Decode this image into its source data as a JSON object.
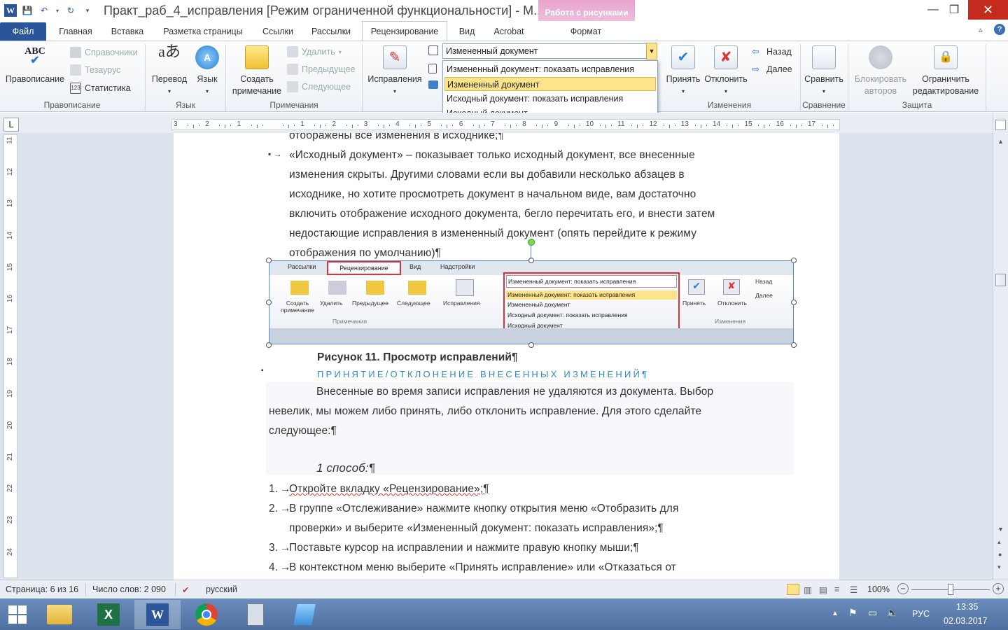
{
  "window": {
    "title": "Практ_раб_4_исправления [Режим ограниченной функциональности]  -  M..",
    "context_tab_title": "Работа с рисунками",
    "minimize_icon": "minimize-icon",
    "restore_icon": "restore-icon",
    "close_icon": "close-icon"
  },
  "tabs": [
    {
      "label": "Файл"
    },
    {
      "label": "Главная"
    },
    {
      "label": "Вставка"
    },
    {
      "label": "Разметка страницы"
    },
    {
      "label": "Ссылки"
    },
    {
      "label": "Рассылки"
    },
    {
      "label": "Рецензирование"
    },
    {
      "label": "Вид"
    },
    {
      "label": "Acrobat"
    },
    {
      "label": "Формат"
    }
  ],
  "ribbon": {
    "spelling": {
      "label": "Правописание",
      "references": "Справочники",
      "thesaurus": "Тезаурус",
      "stats": "Статистика",
      "group": "Правописание"
    },
    "language": {
      "translate": "Перевод",
      "lang": "Язык",
      "group": "Язык"
    },
    "comments": {
      "create": "Создать примечание",
      "delete": "Удалить",
      "prev": "Предыдущее",
      "next": "Следующее",
      "group": "Примечания"
    },
    "tracking": {
      "track": "Исправления"
    },
    "display_dropdown": {
      "value": "Измененный документ",
      "options": [
        "Измененный документ: показать исправления",
        "Измененный документ",
        "Исходный документ: показать исправления",
        "Исходный документ"
      ]
    },
    "changes": {
      "accept": "Принять",
      "reject": "Отклонить",
      "back": "Назад",
      "forward": "Далее",
      "group": "Изменения"
    },
    "compare": {
      "label": "Сравнить",
      "group": "Сравнение"
    },
    "protect": {
      "block": "Блокировать авторов",
      "restrict": "Ограничить редактирование",
      "group": "Защита"
    }
  },
  "document": {
    "lines": [
      "отображены все изменения в исходнике;¶",
      "«Исходный документ» – показывает только исходный документ, все внесенные",
      "изменения скрыты. Другими словами если вы добавили несколько абзацев в",
      "исходнике, но хотите просмотреть документ в начальном виде, вам достаточно",
      "включить отображение исходного документа, бегло перечитать его, и внести затем",
      "недостающие исправления в измененный документ (опять перейдите к режиму",
      "отображения по умолчанию)¶"
    ],
    "figure": {
      "tabs": [
        "Рассылки",
        "Рецензирование",
        "Вид",
        "Надстройки"
      ],
      "buttons": [
        "Создать примечание",
        "Удалить",
        "Предыдущее",
        "Следующее",
        "Исправления",
        "Принять",
        "Отклонить",
        "Назад",
        "Далее"
      ],
      "group_comments": "Примечания",
      "group_changes": "Изменения",
      "dropdown_value": "Измененный документ: показать исправления",
      "dropdown_options": [
        "Измененный документ: показать исправления",
        "Измененный документ",
        "Исходный документ: показать исправления",
        "Исходный документ"
      ]
    },
    "caption": "Рисунок 11. Просмотр исправлений¶",
    "heading": "ПРИНЯТИЕ/ОТКЛОНЕНИЕ ВНЕСЕННЫХ ИЗМЕНЕНИЙ¶",
    "para": [
      "Внесенные во время записи исправления не удаляются из документа. Выбор",
      "невелик, мы можем либо принять, либо отклонить исправление. Для этого сделайте",
      "следующее:¶"
    ],
    "method": "1 способ:¶",
    "list": [
      {
        "num": "1.",
        "text": "Откройте вкладку «Рецензирование»;¶"
      },
      {
        "num": "2.",
        "text": "В группе «Отслеживание» нажмите кнопку открытия меню «Отобразить для"
      },
      {
        "num": "",
        "text": "проверки» и выберите «Измененный документ: показать исправления»;¶"
      },
      {
        "num": "3.",
        "text": "Поставьте курсор на исправлении и нажмите правую кнопку мыши;¶"
      },
      {
        "num": "4.",
        "text": "В контекстном меню выберите «Принять исправление» или «Отказаться от"
      }
    ]
  },
  "status": {
    "page": "Страница: 6 из 16",
    "words": "Число слов: 2 090",
    "lang": "русский",
    "zoom": "100%"
  },
  "taskbar": {
    "lang": "РУС",
    "time": "13:35",
    "date": "02.03.2017"
  }
}
